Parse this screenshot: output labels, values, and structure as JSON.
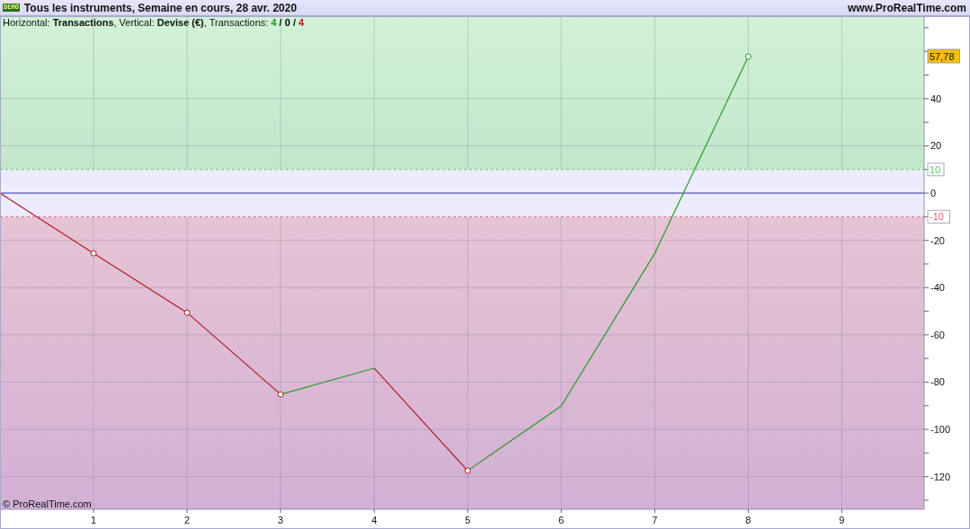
{
  "header": {
    "badge": "DEMO",
    "title": "Tous les instruments, Semaine en cours, 28 avr. 2020",
    "site": "www.ProRealTime.com"
  },
  "info": {
    "text": "Horizontal: **Transactions**, Vertical: **Devise (€)**, Transactions:",
    "separator": "/",
    "counts": [
      {
        "text": "4",
        "color": "#1f9a1f"
      },
      {
        "text": "0",
        "color": "#000000"
      },
      {
        "text": "4",
        "color": "#c01818"
      }
    ]
  },
  "chart_data": {
    "type": "line",
    "grid": true,
    "x": [
      0,
      1,
      2,
      3,
      4,
      5,
      6,
      7,
      8
    ],
    "series": [
      {
        "color": "#b01c28",
        "values": [
          0,
          -25.5,
          -50.6,
          -85.2,
          null,
          null,
          null,
          null,
          null
        ]
      },
      {
        "color": "#2a9a2a",
        "values": [
          null,
          null,
          null,
          -85.2,
          -74.1,
          null,
          null,
          null,
          null
        ]
      },
      {
        "color": "#b01c28",
        "values": [
          null,
          null,
          null,
          null,
          -74.1,
          -117.5,
          null,
          null,
          null
        ]
      },
      {
        "color": "#2a9a2a",
        "values": [
          null,
          null,
          null,
          null,
          null,
          -117.5,
          -90.1,
          -25.5,
          57.8
        ]
      },
      {
        "color": "#ffffff",
        "type": "scatter",
        "values": [
          null,
          -25.5,
          -50.6,
          -85.2,
          null,
          -117.5,
          null,
          null,
          57.8
        ]
      }
    ],
    "xlim": [
      0,
      9.88
    ],
    "ylim": [
      -133.8,
      74.9
    ],
    "xticks": [
      1,
      2,
      3,
      4,
      5,
      6,
      7,
      8,
      9
    ],
    "yticks": [
      {
        "value": 40,
        "label": "40"
      },
      {
        "value": 20,
        "label": "20"
      },
      {
        "value": 0,
        "label": "0"
      },
      {
        "value": -20,
        "label": "-20"
      },
      {
        "value": -40,
        "label": "-40"
      },
      {
        "value": -60,
        "label": "-60"
      },
      {
        "value": -80,
        "label": "-80"
      },
      {
        "value": -100,
        "label": "-100"
      },
      {
        "value": -120,
        "label": "-120"
      }
    ],
    "ref_lines": [
      {
        "axis": "y",
        "value": 10,
        "label": "10",
        "color": "#5fcc5f"
      },
      {
        "axis": "y",
        "value": 0,
        "color": "#3030a0"
      },
      {
        "axis": "y",
        "value": -10,
        "label": "-10",
        "color": "#e06070"
      }
    ],
    "bands": [
      {
        "axis": "y",
        "from": -10,
        "to": 10,
        "color": "#ececfc"
      }
    ],
    "annotations": [
      "57,78"
    ]
  },
  "copyright": "© ProRealTime.com"
}
